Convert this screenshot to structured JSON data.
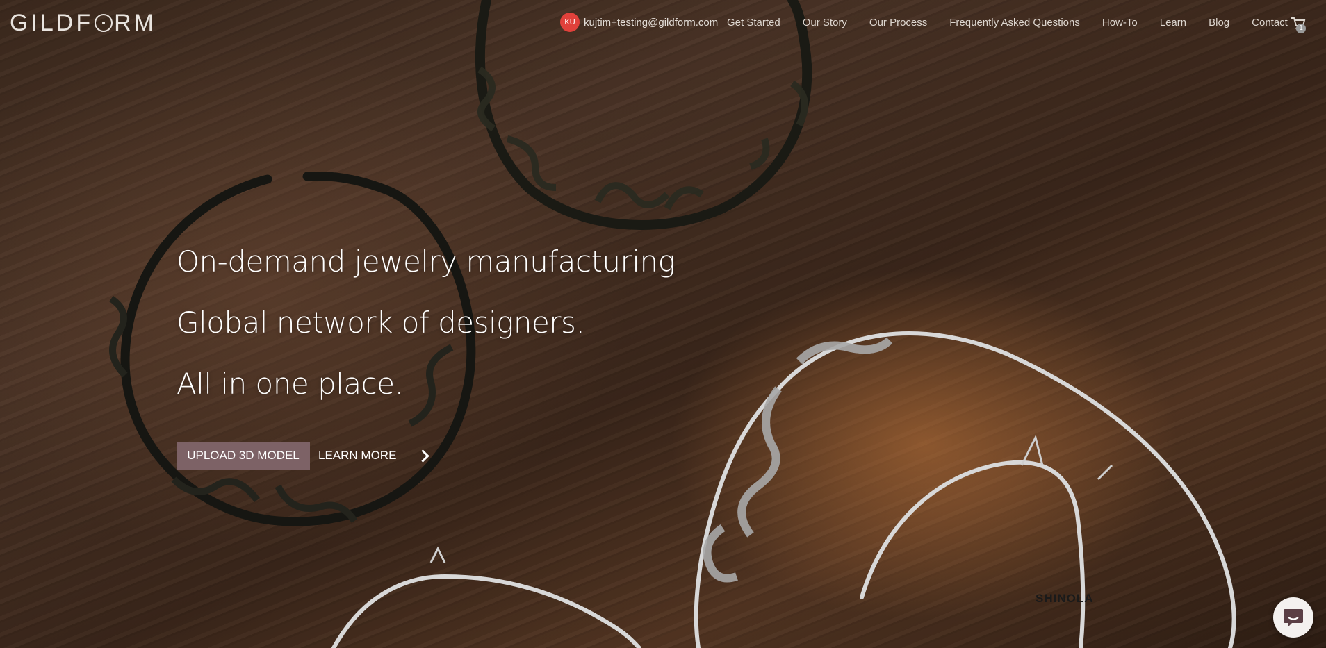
{
  "brand": {
    "logo_text_left": "GILDF",
    "logo_text_right": "RM"
  },
  "nav": {
    "user": {
      "initials": "KU",
      "email": "kujtim+testing@gildform.com"
    },
    "items": [
      {
        "label": "Get Started"
      },
      {
        "label": "Our Story"
      },
      {
        "label": "Our Process"
      },
      {
        "label": "Frequently Asked Questions"
      },
      {
        "label": "How-To"
      },
      {
        "label": "Learn"
      },
      {
        "label": "Blog"
      },
      {
        "label": "Contact"
      }
    ],
    "cart_count": "1"
  },
  "hero": {
    "line1": "On-demand jewelry manufacturing",
    "line2": "Global network of designers.",
    "line3": "All in one place.",
    "upload_button": "UPLOAD 3D MODEL",
    "learn_more": "LEARN MORE"
  },
  "partners": {
    "shinola": "SHINOLA"
  },
  "colors": {
    "accent_button": "#7d6266",
    "avatar": "#e0413b"
  }
}
